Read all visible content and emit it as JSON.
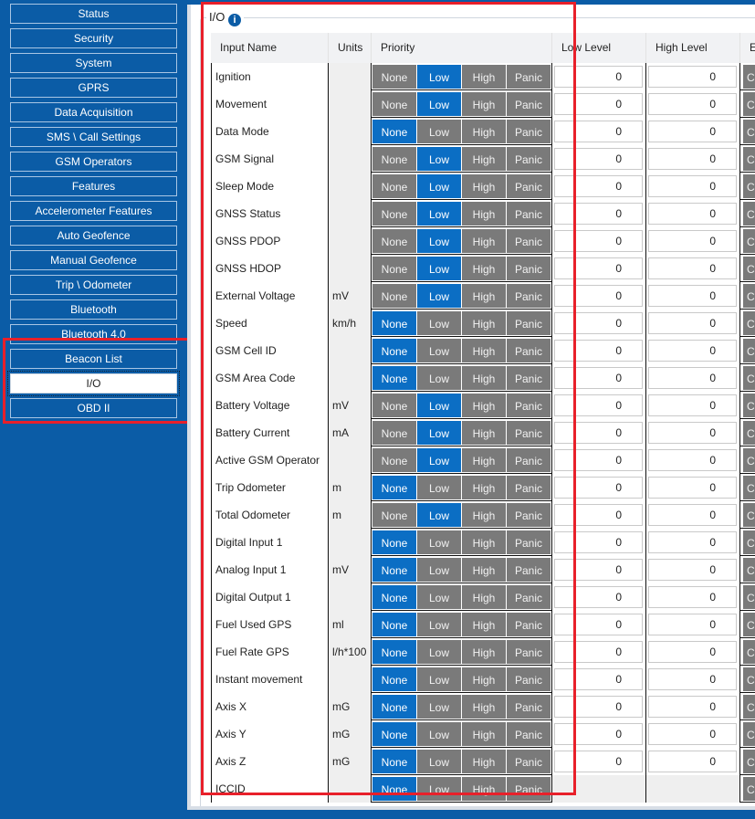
{
  "sidebar": {
    "items": [
      "Status",
      "Security",
      "System",
      "GPRS",
      "Data Acquisition",
      "SMS \\ Call Settings",
      "GSM Operators",
      "Features",
      "Accelerometer Features",
      "Auto Geofence",
      "Manual Geofence",
      "Trip \\ Odometer",
      "Bluetooth",
      "Bluetooth 4.0",
      "Beacon List",
      "I/O",
      "OBD II"
    ],
    "active": "I/O"
  },
  "group": {
    "title": "I/O",
    "info_icon": "i"
  },
  "table": {
    "headers": [
      "Input Name",
      "Units",
      "Priority",
      "Low Level",
      "High Level",
      "Ev"
    ],
    "priority_options": [
      "None",
      "Low",
      "High",
      "Panic"
    ],
    "event_label": "C",
    "rows": [
      {
        "name": "Ignition",
        "units": "",
        "priority": "Low",
        "low": "0",
        "high": "0"
      },
      {
        "name": "Movement",
        "units": "",
        "priority": "Low",
        "low": "0",
        "high": "0"
      },
      {
        "name": "Data Mode",
        "units": "",
        "priority": "None",
        "low": "0",
        "high": "0"
      },
      {
        "name": "GSM Signal",
        "units": "",
        "priority": "Low",
        "low": "0",
        "high": "0"
      },
      {
        "name": "Sleep Mode",
        "units": "",
        "priority": "Low",
        "low": "0",
        "high": "0"
      },
      {
        "name": "GNSS Status",
        "units": "",
        "priority": "Low",
        "low": "0",
        "high": "0"
      },
      {
        "name": "GNSS PDOP",
        "units": "",
        "priority": "Low",
        "low": "0",
        "high": "0"
      },
      {
        "name": "GNSS HDOP",
        "units": "",
        "priority": "Low",
        "low": "0",
        "high": "0"
      },
      {
        "name": "External Voltage",
        "units": "mV",
        "priority": "Low",
        "low": "0",
        "high": "0"
      },
      {
        "name": "Speed",
        "units": "km/h",
        "priority": "None",
        "low": "0",
        "high": "0"
      },
      {
        "name": "GSM Cell ID",
        "units": "",
        "priority": "None",
        "low": "0",
        "high": "0"
      },
      {
        "name": "GSM Area Code",
        "units": "",
        "priority": "None",
        "low": "0",
        "high": "0"
      },
      {
        "name": "Battery Voltage",
        "units": "mV",
        "priority": "Low",
        "low": "0",
        "high": "0"
      },
      {
        "name": "Battery Current",
        "units": "mA",
        "priority": "Low",
        "low": "0",
        "high": "0"
      },
      {
        "name": "Active GSM Operator",
        "units": "",
        "priority": "Low",
        "low": "0",
        "high": "0"
      },
      {
        "name": "Trip Odometer",
        "units": "m",
        "priority": "None",
        "low": "0",
        "high": "0"
      },
      {
        "name": "Total Odometer",
        "units": "m",
        "priority": "Low",
        "low": "0",
        "high": "0"
      },
      {
        "name": "Digital Input 1",
        "units": "",
        "priority": "None",
        "low": "0",
        "high": "0"
      },
      {
        "name": "Analog Input 1",
        "units": "mV",
        "priority": "None",
        "low": "0",
        "high": "0"
      },
      {
        "name": "Digital Output 1",
        "units": "",
        "priority": "None",
        "low": "0",
        "high": "0"
      },
      {
        "name": "Fuel Used GPS",
        "units": "ml",
        "priority": "None",
        "low": "0",
        "high": "0"
      },
      {
        "name": "Fuel Rate GPS",
        "units": "l/h*100",
        "priority": "None",
        "low": "0",
        "high": "0"
      },
      {
        "name": "Instant movement",
        "units": "",
        "priority": "None",
        "low": "0",
        "high": "0"
      },
      {
        "name": "Axis X",
        "units": "mG",
        "priority": "None",
        "low": "0",
        "high": "0"
      },
      {
        "name": "Axis Y",
        "units": "mG",
        "priority": "None",
        "low": "0",
        "high": "0"
      },
      {
        "name": "Axis Z",
        "units": "mG",
        "priority": "None",
        "low": "0",
        "high": "0"
      },
      {
        "name": "ICCID",
        "units": "",
        "priority": "None",
        "low": null,
        "high": null
      }
    ]
  }
}
